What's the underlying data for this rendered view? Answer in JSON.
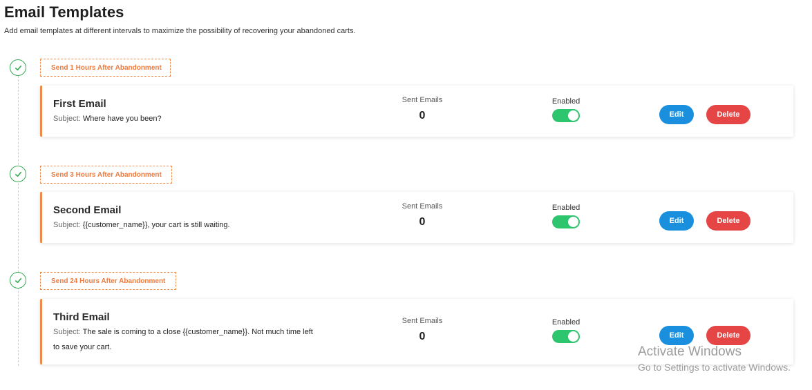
{
  "header": {
    "title": "Email Templates",
    "subtitle": "Add email templates at different intervals to maximize the possibility of recovering your abandoned carts."
  },
  "templates": [
    {
      "badge": "Send 1 Hours After Abandonment",
      "name": "First Email",
      "subject_label": "Subject:",
      "subject": "Where have you been?",
      "sent_label": "Sent Emails",
      "sent_value": "0",
      "enabled_label": "Enabled",
      "enabled": true,
      "edit_label": "Edit",
      "delete_label": "Delete"
    },
    {
      "badge": "Send 3 Hours After Abandonment",
      "name": "Second Email",
      "subject_label": "Subject:",
      "subject": "{{customer_name}}, your cart is still waiting.",
      "sent_label": "Sent Emails",
      "sent_value": "0",
      "enabled_label": "Enabled",
      "enabled": true,
      "edit_label": "Edit",
      "delete_label": "Delete"
    },
    {
      "badge": "Send 24 Hours After Abandonment",
      "name": "Third Email",
      "subject_label": "Subject:",
      "subject_line1": "The sale is coming to a close {{customer_name}}. Not much time left",
      "subject_line2": "to save your cart.",
      "sent_label": "Sent Emails",
      "sent_value": "0",
      "enabled_label": "Enabled",
      "enabled": true,
      "edit_label": "Edit",
      "delete_label": "Delete"
    }
  ],
  "colors": {
    "accent_orange": "#f08a4b",
    "check_green": "#34a853",
    "toggle_green": "#2ec56f",
    "edit_blue": "#1a8fdd",
    "delete_red": "#e64545"
  },
  "icons": {
    "step": "check-icon"
  },
  "watermark": {
    "line1": "Activate Windows",
    "line2": "Go to Settings to activate Windows."
  }
}
